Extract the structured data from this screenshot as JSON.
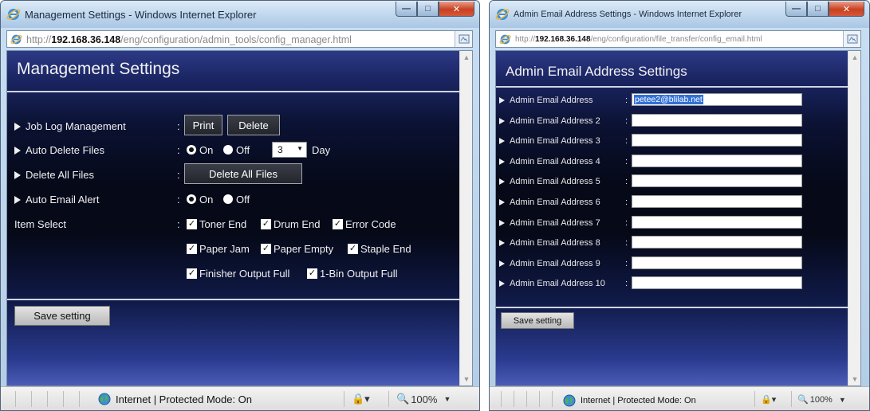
{
  "left_window": {
    "title": "Management Settings - Windows Internet Explorer",
    "url": {
      "prefix": "http://",
      "host": "192.168.36.148",
      "path": "/eng/configuration/admin_tools/config_manager.html"
    },
    "page_title": "Management Settings",
    "rows": {
      "job_log": {
        "label": "Job Log Management",
        "print": "Print",
        "delete": "Delete"
      },
      "auto_delete": {
        "label": "Auto Delete Files",
        "on": "On",
        "off": "Off",
        "days_value": "3",
        "day_unit": "Day",
        "selected": "On"
      },
      "delete_all": {
        "label": "Delete All Files",
        "button": "Delete All Files"
      },
      "auto_email": {
        "label": "Auto Email Alert",
        "on": "On",
        "off": "Off",
        "selected": "On"
      },
      "item_select": {
        "label": "Item Select",
        "items": [
          "Toner End",
          "Drum End",
          "Error Code",
          "Paper Jam",
          "Paper Empty",
          "Staple End",
          "Finisher Output Full",
          "1-Bin Output Full"
        ]
      }
    },
    "save": "Save setting",
    "status": {
      "zone": "Internet | Protected Mode: On",
      "zoom": "100%"
    }
  },
  "right_window": {
    "title": "Admin Email Address Settings - Windows Internet Explorer",
    "url": {
      "prefix": "http://",
      "host": "192.168.36.148",
      "path": "/eng/configuration/file_transfer/config_email.html"
    },
    "page_title": "Admin Email Address Settings",
    "emails": [
      {
        "label": "Admin Email Address",
        "value": "petee2@blilab.net"
      },
      {
        "label": "Admin Email Address 2",
        "value": ""
      },
      {
        "label": "Admin Email Address 3",
        "value": ""
      },
      {
        "label": "Admin Email Address 4",
        "value": ""
      },
      {
        "label": "Admin Email Address 5",
        "value": ""
      },
      {
        "label": "Admin Email Address 6",
        "value": ""
      },
      {
        "label": "Admin Email Address 7",
        "value": ""
      },
      {
        "label": "Admin Email Address 8",
        "value": ""
      },
      {
        "label": "Admin Email Address 9",
        "value": ""
      },
      {
        "label": "Admin Email Address 10",
        "value": ""
      }
    ],
    "save": "Save setting",
    "status": {
      "zone": "Internet | Protected Mode: On",
      "zoom": "100%"
    }
  },
  "icons": {
    "browser": "ie-icon",
    "zone": "globe-icon",
    "security": "lock-icon",
    "zoom": "zoom-icon",
    "compat": "compat-view-icon"
  },
  "colors": {
    "page_top": "#2d3a86",
    "page_dark": "#050918",
    "page_bottom": "#4a5cb6",
    "close_button": "#c9401f"
  }
}
